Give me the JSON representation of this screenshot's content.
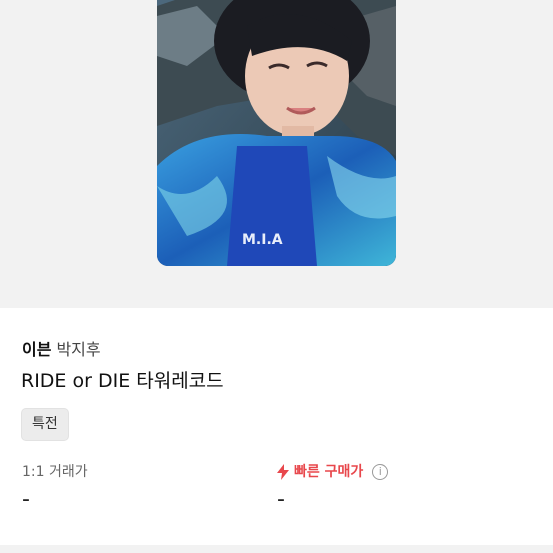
{
  "product": {
    "artist_group": "이븐",
    "artist_member": "박지후",
    "title": "RIDE or DIE 타워레코드",
    "tag": "특전"
  },
  "prices": {
    "trade_label": "1:1 거래가",
    "trade_value": "-",
    "quick_label": "빠른 구매가",
    "quick_value": "-",
    "info_glyph": "i"
  },
  "colors": {
    "accent": "#e8474c",
    "background_hero": "#f2f2f2"
  },
  "icons": {
    "quick_buy": "lightning-bolt-icon",
    "info": "info-circle-icon"
  }
}
